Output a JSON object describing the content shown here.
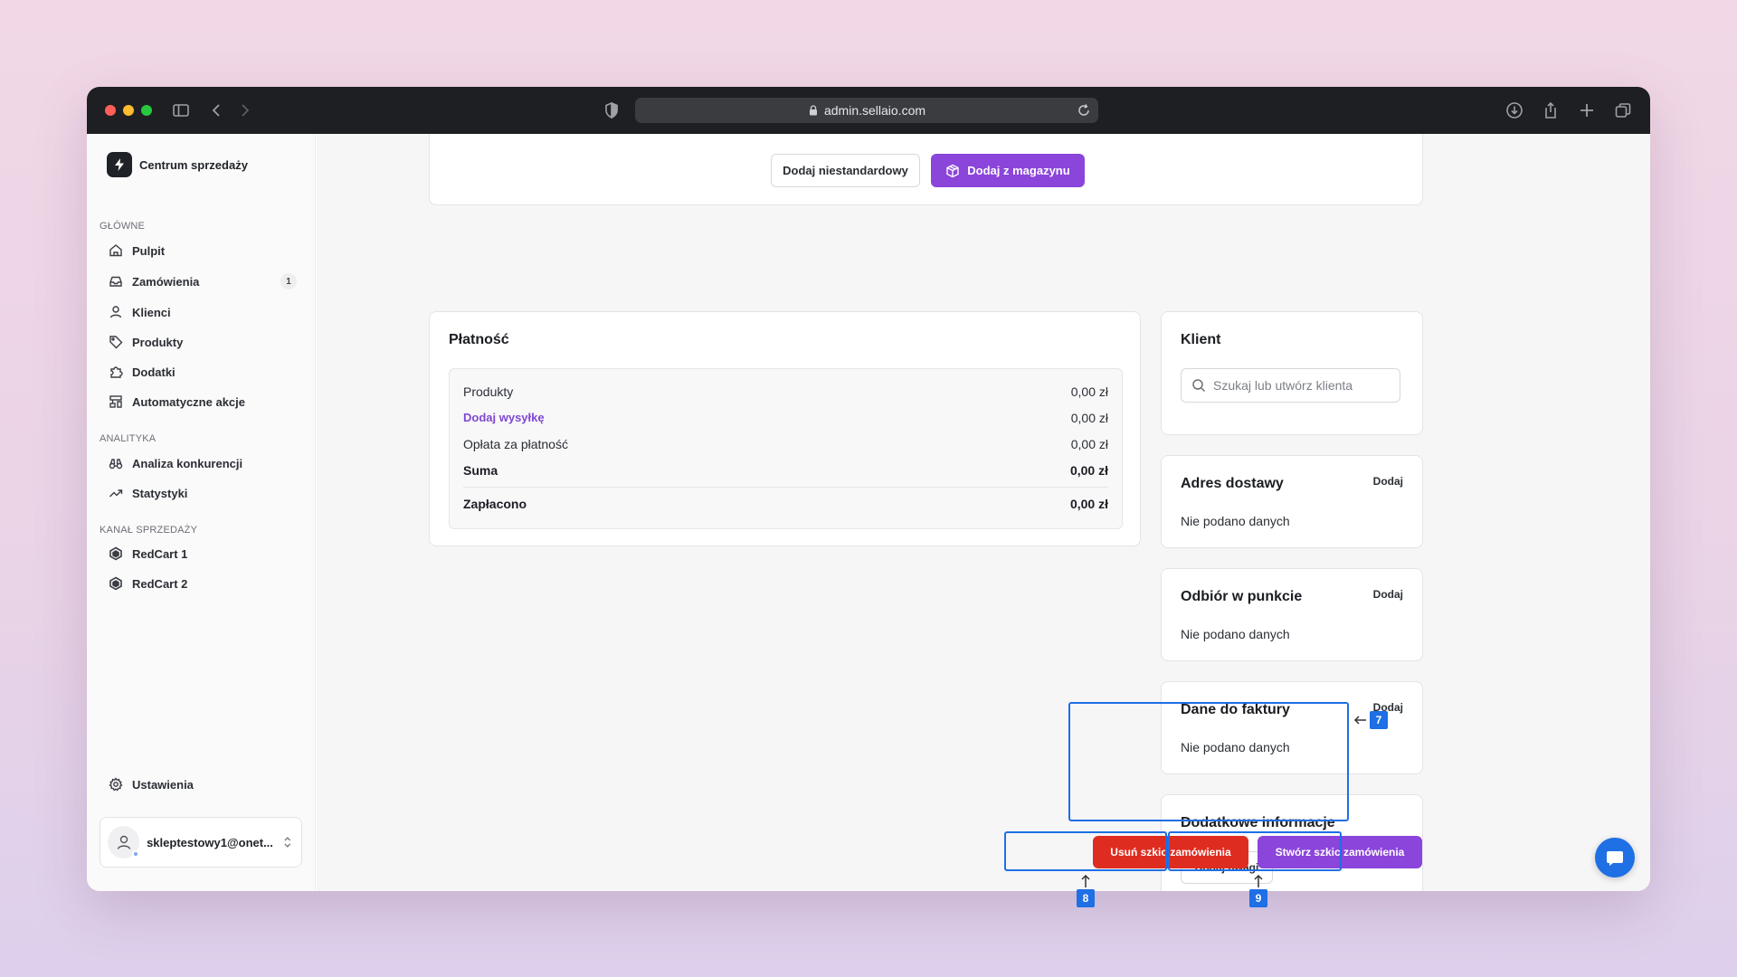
{
  "browser": {
    "url": "admin.sellaio.com"
  },
  "sidebar": {
    "brand": "Centrum sprzedaży",
    "sections": {
      "main": "GŁÓWNE",
      "analytics": "ANALITYKA",
      "channels": "KANAŁ SPRZEDAŻY"
    },
    "items": [
      {
        "label": "Pulpit",
        "icon": "home-icon"
      },
      {
        "label": "Zamówienia",
        "icon": "inbox-icon",
        "badge": "1"
      },
      {
        "label": "Klienci",
        "icon": "user-icon"
      },
      {
        "label": "Produkty",
        "icon": "tag-icon"
      },
      {
        "label": "Dodatki",
        "icon": "puzzle-icon"
      },
      {
        "label": "Automatyczne akcje",
        "icon": "workflow-icon"
      },
      {
        "label": "Analiza konkurencji",
        "icon": "binoculars-icon"
      },
      {
        "label": "Statystyki",
        "icon": "trending-up-icon"
      },
      {
        "label": "RedCart 1",
        "icon": "hexagon-icon"
      },
      {
        "label": "RedCart 2",
        "icon": "hexagon-icon"
      },
      {
        "label": "Ustawienia",
        "icon": "gear-icon"
      }
    ],
    "user_email": "skleptestowy1@onet..."
  },
  "products_card": {
    "add_custom": "Dodaj niestandardowy",
    "add_from_stock": "Dodaj z magazynu"
  },
  "payment": {
    "title": "Płatność",
    "rows": [
      {
        "label": "Produkty",
        "value": "0,00 zł"
      },
      {
        "label": "Dodaj wysyłkę",
        "value": "0,00 zł"
      },
      {
        "label": "Opłata za płatność",
        "value": "0,00 zł"
      },
      {
        "label": "Suma",
        "value": "0,00 zł"
      },
      {
        "label": "Zapłacono",
        "value": "0,00 zł"
      }
    ]
  },
  "client": {
    "title": "Klient",
    "search_placeholder": "Szukaj lub utwórz klienta"
  },
  "shipping_address": {
    "title": "Adres dostawy",
    "add": "Dodaj",
    "empty": "Nie podano danych"
  },
  "pickup_point": {
    "title": "Odbiór w punkcie",
    "add": "Dodaj",
    "empty": "Nie podano danych"
  },
  "invoice_data": {
    "title": "Dane do faktury",
    "add": "Dodaj",
    "empty": "Nie podano danych"
  },
  "additional_info": {
    "title": "Dodatkowe informacje",
    "add_notes": "Dodaj uwagi"
  },
  "actions": {
    "delete_draft": "Usuń szkic zamówienia",
    "create_draft": "Stwórz szkic zamówienia"
  },
  "annotations": [
    "7",
    "8",
    "9"
  ],
  "colors": {
    "accent": "#8b45db",
    "danger": "#df2c20",
    "annotation": "#1f6fe5"
  }
}
